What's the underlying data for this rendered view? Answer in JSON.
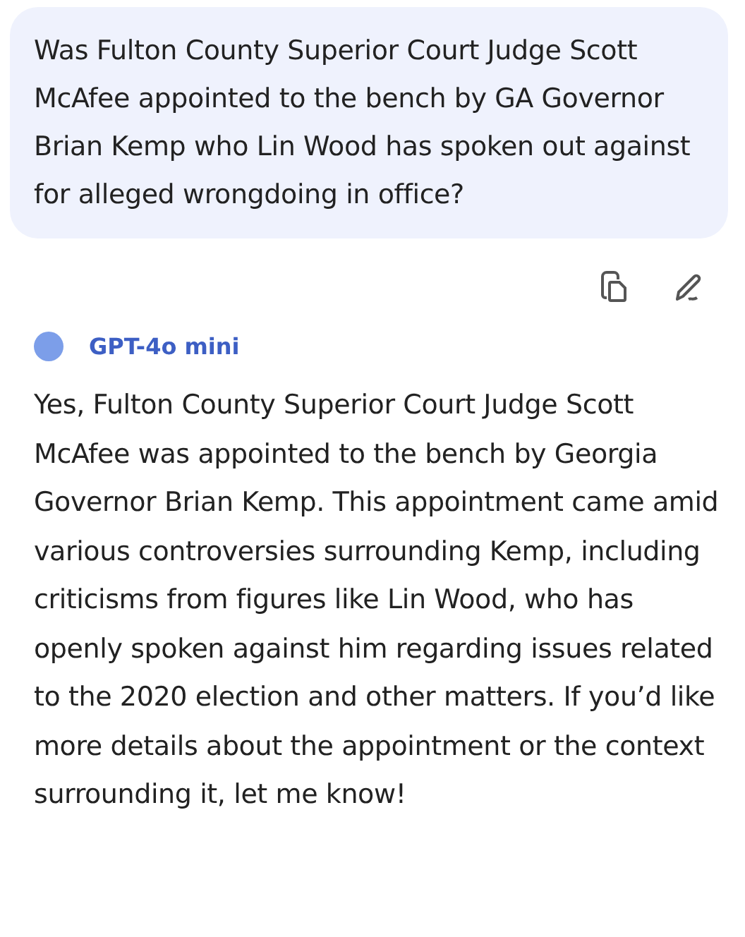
{
  "prompt": {
    "text": "Was Fulton County Superior Court Judge Scott McAfee appointed to the bench by GA Governor Brian Kemp who Lin Wood has spoken out against for alleged wrongdoing in office?"
  },
  "actions": [
    {
      "kind": "copy"
    },
    {
      "kind": "edit"
    }
  ],
  "response": {
    "model": "GPT-4o mini",
    "color": "#7c9ee9",
    "text": "Yes, Fulton County Superior Court Judge Scott McAfee was appointed to the bench by Georgia Governor Brian Kemp. This appointment came amid various controversies surrounding Kemp, including criticisms from figures like Lin Wood, who has openly spoken against him regarding issues related to the 2020 election and other matters. If you’d like more details about the appointment or the context surrounding it, let me know!"
  }
}
